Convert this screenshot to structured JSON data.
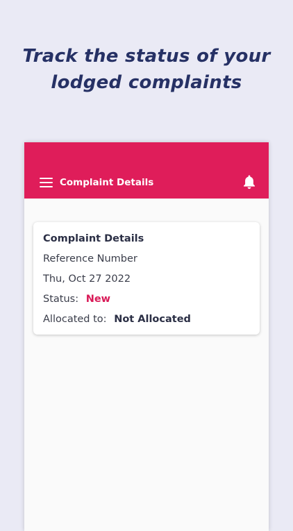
{
  "headline": {
    "line1": "Track the status of your",
    "line2": "lodged complaints"
  },
  "colors": {
    "background": "#eaeaf5",
    "headline": "#263165",
    "appbar": "#df1d5a",
    "status_new": "#d91b58"
  },
  "appbar": {
    "menu_icon": "hamburger-menu-icon",
    "title": "Complaint Details",
    "notification_icon": "bell-icon"
  },
  "complaint_card": {
    "title": "Complaint Details",
    "reference_number": "Reference Number",
    "date": "Thu, Oct 27 2022",
    "status_label": "Status:",
    "status_value": "New",
    "allocated_label": "Allocated to:",
    "allocated_value": "Not Allocated"
  }
}
